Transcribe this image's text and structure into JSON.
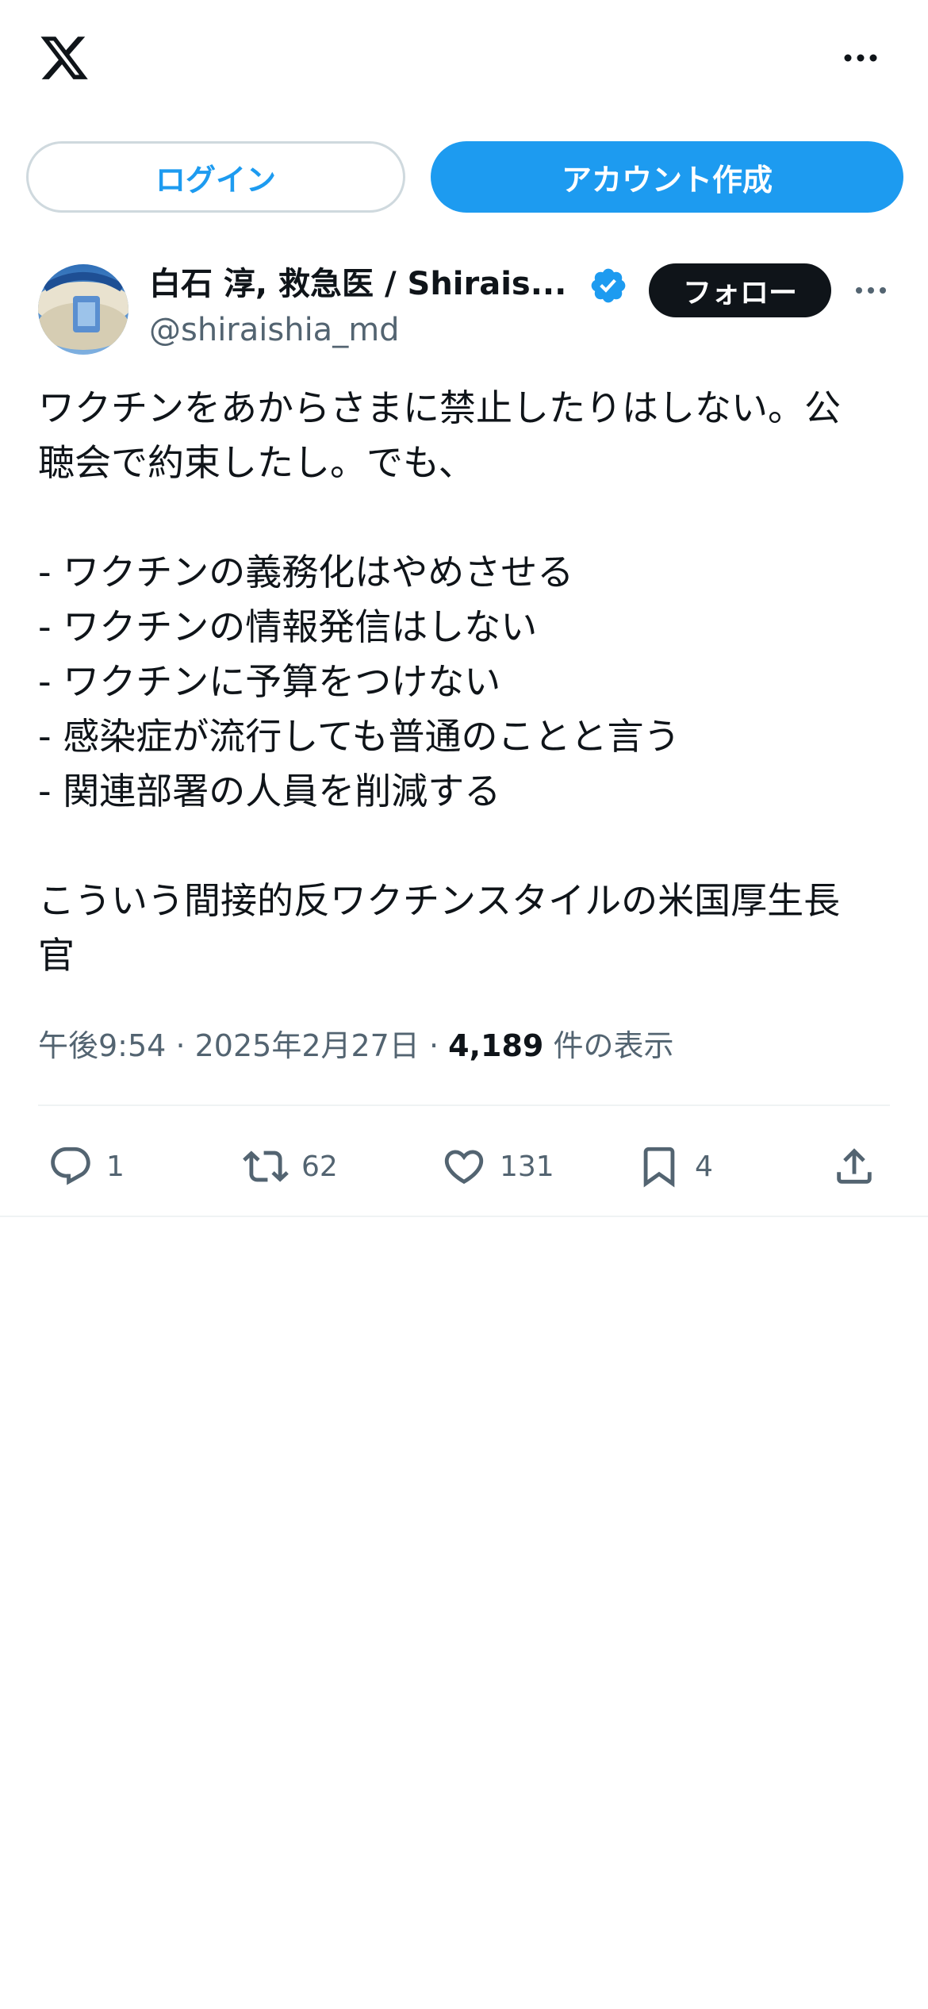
{
  "header": {
    "logo_icon": "x-logo-icon",
    "more_icon": "more-horizontal-icon"
  },
  "auth": {
    "login_label": "ログイン",
    "signup_label": "アカウント作成"
  },
  "post": {
    "display_name": "白石 淳, 救急医 / Shirais...",
    "verified_icon": "verified-badge-icon",
    "handle": "@shiraishia_md",
    "follow_label": "フォロー",
    "text": "ワクチンをあからさまに禁止したりはしない。公\n聴会で約束したし。でも、\n\n- ワクチンの義務化はやめさせる\n- ワクチンの情報発信はしない\n- ワクチンに予算をつけない\n- 感染症が流行しても普通のことと言う\n- 関連部署の人員を削減する\n\nこういう間接的反ワクチンスタイルの米国厚生長\n官",
    "time": "午後9:54",
    "date": "2025年2月27日",
    "separator": "·",
    "views_count": "4,189",
    "views_label": "件の表示"
  },
  "actions": {
    "reply_count": "1",
    "repost_count": "62",
    "like_count": "131",
    "bookmark_count": "4"
  },
  "colors": {
    "accent": "#1d9bf0",
    "text_primary": "#0f1419",
    "text_secondary": "#536471",
    "border": "#cfd9de"
  }
}
